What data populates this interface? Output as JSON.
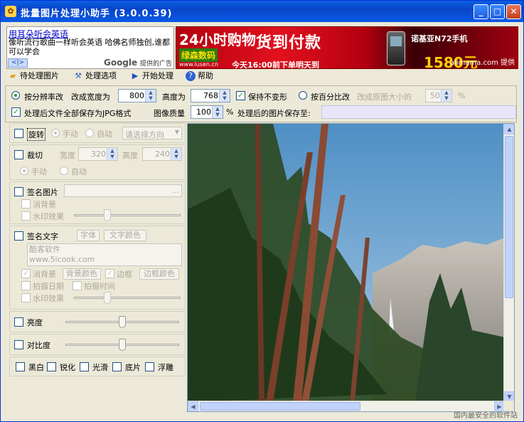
{
  "window": {
    "title": "批量图片处理小助手 (3.0.0.39)",
    "controls": {
      "minimize": "_",
      "maximize": "□",
      "close": "✕"
    }
  },
  "ads": {
    "text_ad": {
      "headline": "用耳朵听会英语",
      "body": "像听流行歌曲一样听会英语 哈佛名师独创,谁都可以学会",
      "nav": "<|>",
      "google": "Google",
      "google_suffix": "提供的广告"
    },
    "banner": {
      "tag": "24小时购物",
      "cod": "货到付款",
      "brand": "绿森数码",
      "url": "www.lusen.cn",
      "time": "今天16:00前下单明天到",
      "phone": "诺基亚N72手机",
      "price": "1580元",
      "provider": "alimama.com 提供"
    }
  },
  "menu": [
    {
      "label": "待处理图片",
      "icon": "folder-icon"
    },
    {
      "label": "处理选项",
      "icon": "tools-icon"
    },
    {
      "label": "开始处理",
      "icon": "play-icon"
    },
    {
      "label": "帮助",
      "icon": "help-icon"
    }
  ],
  "options": {
    "resize_by_resolution": "按分辨率改",
    "width_label": "改成宽度为",
    "width_value": "800",
    "height_label": "高度为",
    "height_value": "768",
    "keep_ratio": "保持不变形",
    "resize_by_percent": "按百分比改",
    "percent_label": "改成原图大小的",
    "percent_value": "50",
    "percent_unit": "%",
    "save_jpg": "处理后文件全部保存为JPG格式",
    "quality_label": "图像质量",
    "quality_value": "100",
    "quality_unit": "%",
    "save_to_label": "处理后的图片保存至:",
    "save_to_value": ""
  },
  "panel": {
    "rotate": {
      "label": "旋转",
      "manual": "手动",
      "auto": "自动",
      "direction": "请选择方向"
    },
    "crop": {
      "label": "裁切",
      "width_label": "宽度",
      "width_value": "320",
      "height_label": "高度",
      "height_value": "240",
      "manual": "手动",
      "auto": "自动"
    },
    "sign_image": {
      "label": "签名图片",
      "browse": "...",
      "remove_bg": "消背景",
      "watermark": "水印效果"
    },
    "sign_text": {
      "label": "签名文字",
      "font_btn": "字体",
      "color_btn": "文字颜色",
      "text_line1": "酷客软件",
      "text_line2": "www.5icook.com",
      "remove_bg": "消背景",
      "bg_color_btn": "背景颜色",
      "border": "边框",
      "border_color_btn": "边框颜色",
      "shoot_date": "拍摄日期",
      "shoot_time": "拍摄时间",
      "watermark": "水印效果"
    },
    "brightness": {
      "label": "亮度",
      "level": 0.5
    },
    "contrast": {
      "label": "对比度",
      "level": 0.5
    },
    "filters": [
      "黑白",
      "锐化",
      "光滑",
      "底片",
      "浮雕"
    ]
  },
  "preview": {
    "watermark": "国内最安全的软件站"
  },
  "colors": {
    "title_bar": "#0a5fe3",
    "window_bg": "#ece9d8",
    "sky": "#5f9cc9",
    "check_green": "#21a121"
  }
}
